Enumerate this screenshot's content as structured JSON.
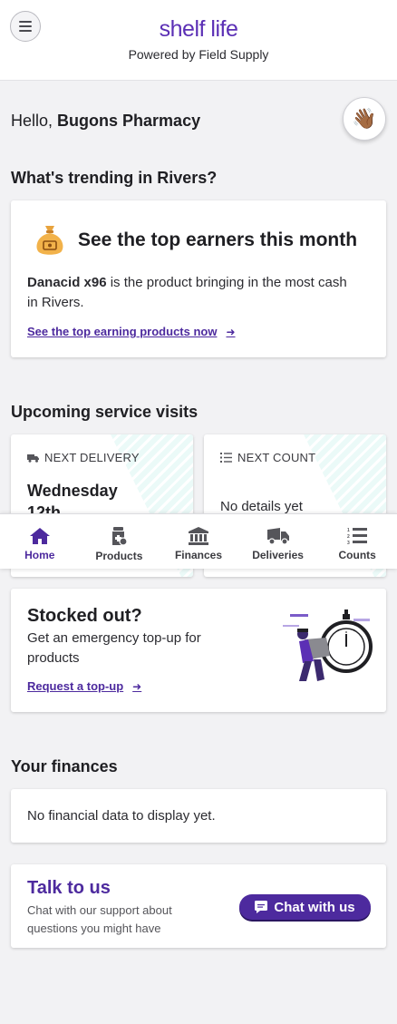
{
  "header": {
    "brand": "shelf life",
    "powered_by": "Powered by Field Supply"
  },
  "greeting": {
    "hello": "Hello,",
    "name": "Bugons Pharmacy"
  },
  "trending": {
    "title": "What's trending in Rivers?",
    "card_title": "See the top earners this month",
    "product": "Danacid x96",
    "body": " is the product bringing in the most cash in Rivers.",
    "link": "See the top earning products now"
  },
  "visits": {
    "title": "Upcoming service visits",
    "delivery": {
      "label": "NEXT DELIVERY",
      "value": "Wednesday",
      "value2": "12th"
    },
    "count": {
      "label": "NEXT COUNT",
      "value": "No details yet"
    }
  },
  "nav": {
    "items": [
      {
        "label": "Home",
        "icon": "home-icon",
        "active": true
      },
      {
        "label": "Products",
        "icon": "products-icon",
        "active": false
      },
      {
        "label": "Finances",
        "icon": "bank-icon",
        "active": false
      },
      {
        "label": "Deliveries",
        "icon": "truck-icon",
        "active": false
      },
      {
        "label": "Counts",
        "icon": "list-icon",
        "active": false
      }
    ]
  },
  "stocked": {
    "title": "Stocked out?",
    "body": "Get an emergency top-up for products",
    "link": "Request a top-up"
  },
  "finances": {
    "title": "Your finances",
    "empty": "No financial data to display yet."
  },
  "talk": {
    "title": "Talk to us",
    "body": "Chat with our support about questions you might have",
    "button": "Chat with us"
  },
  "colors": {
    "accent": "#4d2a9e",
    "brand": "#5b2fb5",
    "background": "#f2f2f4"
  }
}
